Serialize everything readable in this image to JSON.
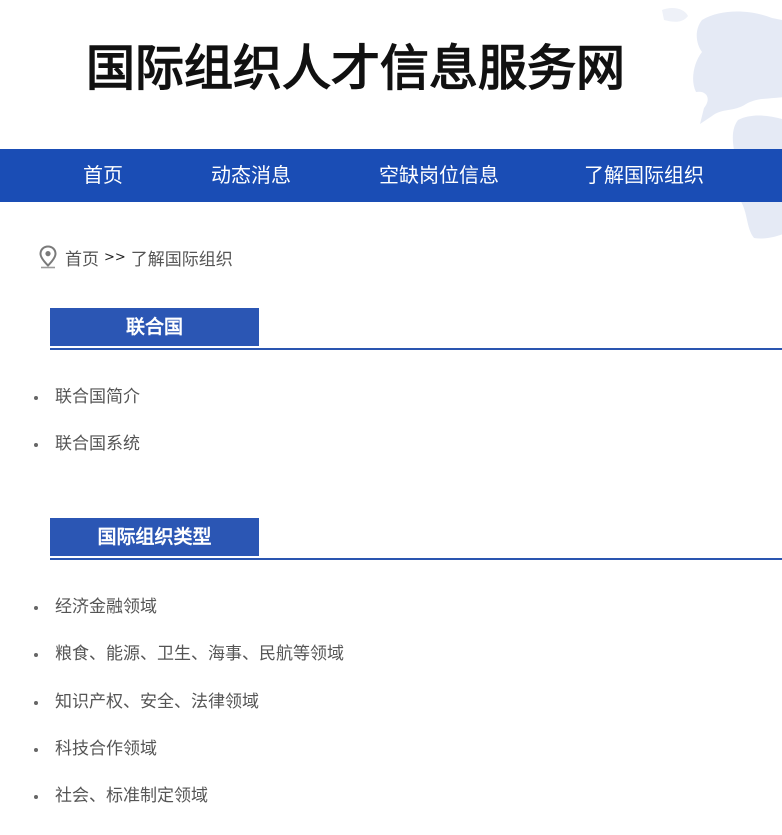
{
  "header": {
    "site_title": "国际组织人才信息服务网"
  },
  "nav": {
    "items": [
      {
        "label": "首页"
      },
      {
        "label": "动态消息"
      },
      {
        "label": "空缺岗位信息"
      },
      {
        "label": "了解国际组织"
      }
    ]
  },
  "breadcrumb": {
    "icon": "location-pin-icon",
    "home": "首页",
    "separator": ">>",
    "current": "了解国际组织"
  },
  "sections": [
    {
      "title": "联合国",
      "items": [
        "联合国简介",
        "联合国系统"
      ]
    },
    {
      "title": "国际组织类型",
      "items": [
        "经济金融领域",
        "粮食、能源、卫生、海事、民航等领域",
        "知识产权、安全、法律领域",
        "科技合作领域",
        "社会、标准制定领域"
      ]
    }
  ],
  "colors": {
    "nav_background": "#1a4db5",
    "section_tab": "#2b56b4",
    "section_rule": "#2a55b0",
    "text": "#555555"
  }
}
